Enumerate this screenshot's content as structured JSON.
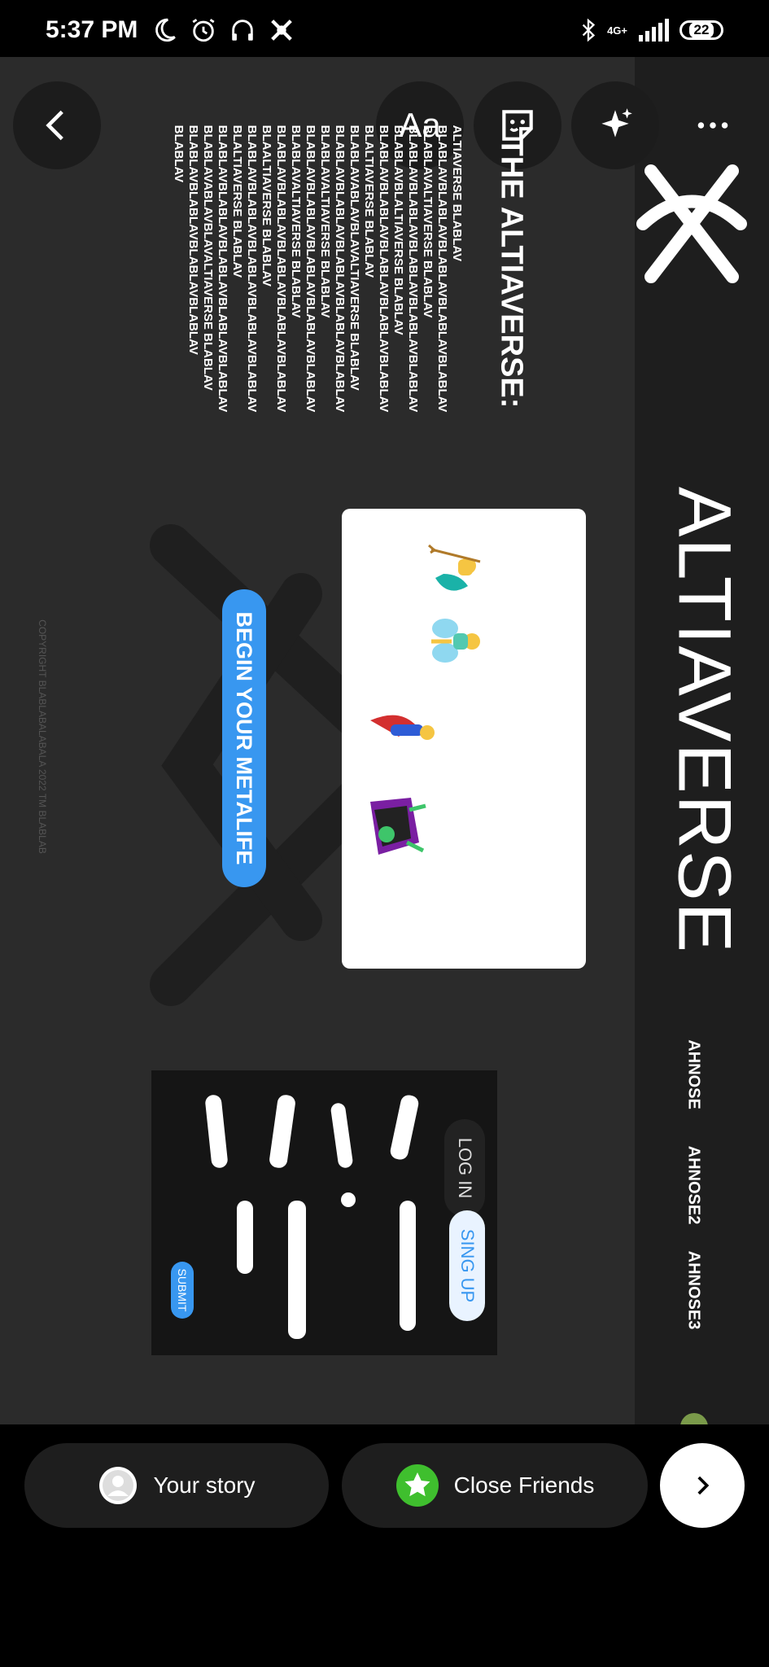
{
  "status_bar": {
    "time": "5:37 PM",
    "network": "4G+",
    "battery": "22",
    "icons": [
      "moon-icon",
      "alarm-icon",
      "headphones-icon",
      "app-icon",
      "bluetooth-icon",
      "signal-icon"
    ]
  },
  "editor_tools": {
    "text_tool_label": "Aa",
    "icons": [
      "back-icon",
      "sticker-icon",
      "effects-icon",
      "more-icon"
    ]
  },
  "story": {
    "logo": "altiaverse-logo",
    "site_title": "ALTIAVERSE",
    "nav": [
      "AHNOSE",
      "AHNOSE2",
      "AHNOSE3"
    ],
    "section_heading": "THE ALTIAVERSE:",
    "body_text": "ALTIAVERSE BLABLAV\nBLABLAVBLABLAVBLABLAVBLABLAVBLABLAV\nBLABLAVALTIAVERSE BLABLAV\nBLABLAVBLABLAVBLABLAVBLABLAVBLABLAV\nBLABLAVBLALTIAVERSE BLABLAV\nBLABLAVBLABLAVBLABLAVBLABLAVBLABLAV\nBLALTIAVERSE BLABLAV\nBLABLAVABLAVBLAVALTIAVERSE BLABLAV\nBLABLAVBLABLAVBLABLAVBLABLAVBLABLAV\nBLABLAVALTIAVERSE BLABLAV\nBLABLAVBLABLAVBLABLAVBLABLAVBLABLAV\nBLABLAVALTIAVERSE BLABLAV\nBLABLAVBLABLAVBLABLAVBLABLAVBLABLAV\nBLAALTIAVERSE BLABLAV\nBLABLAVBLABLAVBLABLAVBLABLAVBLABLAV\nBLALTIAVERSE BLABLAV\nBLABLAVBLABLAVBLABLAVBLABLAVBLABLAV\nBLABLAVABLAVBLAVALTIAVERSE BLABLAV\nBLABLAVBLABLAVBLABLAVBLABLAV\nBLABLAV",
    "cta_label": "BEGIN YOUR METALIFE",
    "copyright": "COPYRIGHT BLABLABALABALA 2022 TM BLABLAB",
    "form": {
      "login_label": "LOG IN",
      "signup_label": "SING UP",
      "submit_label": "SUBMIT"
    },
    "characters": [
      "merperson",
      "fairy",
      "superhero",
      "vampire"
    ]
  },
  "share": {
    "your_story_label": "Your story",
    "close_friends_label": "Close Friends",
    "close_friends_color": "#3fbf2e",
    "accent_color": "#3897f0"
  }
}
